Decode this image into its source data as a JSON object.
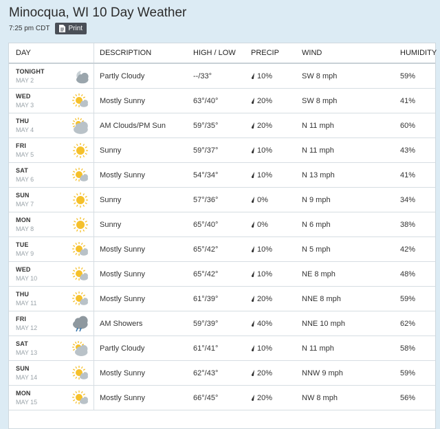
{
  "title": "Minocqua, WI 10 Day Weather",
  "time": "7:25 pm CDT",
  "print_label": "Print",
  "headers": {
    "day": "DAY",
    "description": "DESCRIPTION",
    "high_low": "HIGH / LOW",
    "precip": "PRECIP",
    "wind": "WIND",
    "humidity": "HUMIDITY"
  },
  "rows": [
    {
      "day": "TONIGHT",
      "date": "MAY 2",
      "icon": "partly-cloudy-night-icon",
      "desc": "Partly Cloudy",
      "high": "--",
      "low": "33°",
      "precip": "10%",
      "wind": "SW 8 mph",
      "humidity": "59%"
    },
    {
      "day": "WED",
      "date": "MAY 3",
      "icon": "mostly-sunny-icon",
      "desc": "Mostly Sunny",
      "high": "63°",
      "low": "40°",
      "precip": "20%",
      "wind": "SW 8 mph",
      "humidity": "41%"
    },
    {
      "day": "THU",
      "date": "MAY 4",
      "icon": "cloudy-sun-icon",
      "desc": "AM Clouds/PM Sun",
      "high": "59°",
      "low": "35°",
      "precip": "20%",
      "wind": "N 11 mph",
      "humidity": "60%"
    },
    {
      "day": "FRI",
      "date": "MAY 5",
      "icon": "sunny-icon",
      "desc": "Sunny",
      "high": "59°",
      "low": "37°",
      "precip": "10%",
      "wind": "N 11 mph",
      "humidity": "43%"
    },
    {
      "day": "SAT",
      "date": "MAY 6",
      "icon": "mostly-sunny-icon",
      "desc": "Mostly Sunny",
      "high": "54°",
      "low": "34°",
      "precip": "10%",
      "wind": "N 13 mph",
      "humidity": "41%"
    },
    {
      "day": "SUN",
      "date": "MAY 7",
      "icon": "sunny-icon",
      "desc": "Sunny",
      "high": "57°",
      "low": "36°",
      "precip": "0%",
      "wind": "N 9 mph",
      "humidity": "34%"
    },
    {
      "day": "MON",
      "date": "MAY 8",
      "icon": "sunny-icon",
      "desc": "Sunny",
      "high": "65°",
      "low": "40°",
      "precip": "0%",
      "wind": "N 6 mph",
      "humidity": "38%"
    },
    {
      "day": "TUE",
      "date": "MAY 9",
      "icon": "mostly-sunny-icon",
      "desc": "Mostly Sunny",
      "high": "65°",
      "low": "42°",
      "precip": "10%",
      "wind": "N 5 mph",
      "humidity": "42%"
    },
    {
      "day": "WED",
      "date": "MAY 10",
      "icon": "mostly-sunny-icon",
      "desc": "Mostly Sunny",
      "high": "65°",
      "low": "42°",
      "precip": "10%",
      "wind": "NE 8 mph",
      "humidity": "48%"
    },
    {
      "day": "THU",
      "date": "MAY 11",
      "icon": "mostly-sunny-icon",
      "desc": "Mostly Sunny",
      "high": "61°",
      "low": "39°",
      "precip": "20%",
      "wind": "NNE 8 mph",
      "humidity": "59%"
    },
    {
      "day": "FRI",
      "date": "MAY 12",
      "icon": "showers-icon",
      "desc": "AM Showers",
      "high": "59°",
      "low": "39°",
      "precip": "40%",
      "wind": "NNE 10 mph",
      "humidity": "62%"
    },
    {
      "day": "SAT",
      "date": "MAY 13",
      "icon": "partly-cloudy-icon",
      "desc": "Partly Cloudy",
      "high": "61°",
      "low": "41°",
      "precip": "10%",
      "wind": "N 11 mph",
      "humidity": "58%"
    },
    {
      "day": "SUN",
      "date": "MAY 14",
      "icon": "mostly-sunny-icon",
      "desc": "Mostly Sunny",
      "high": "62°",
      "low": "43°",
      "precip": "20%",
      "wind": "NNW 9 mph",
      "humidity": "59%"
    },
    {
      "day": "MON",
      "date": "MAY 15",
      "icon": "mostly-sunny-icon",
      "desc": "Mostly Sunny",
      "high": "66°",
      "low": "45°",
      "precip": "20%",
      "wind": "NW 8 mph",
      "humidity": "56%"
    }
  ],
  "colors": {
    "sun": "#f5c02b",
    "cloud": "#b9c2c8",
    "drop": "#2d6fa8"
  }
}
